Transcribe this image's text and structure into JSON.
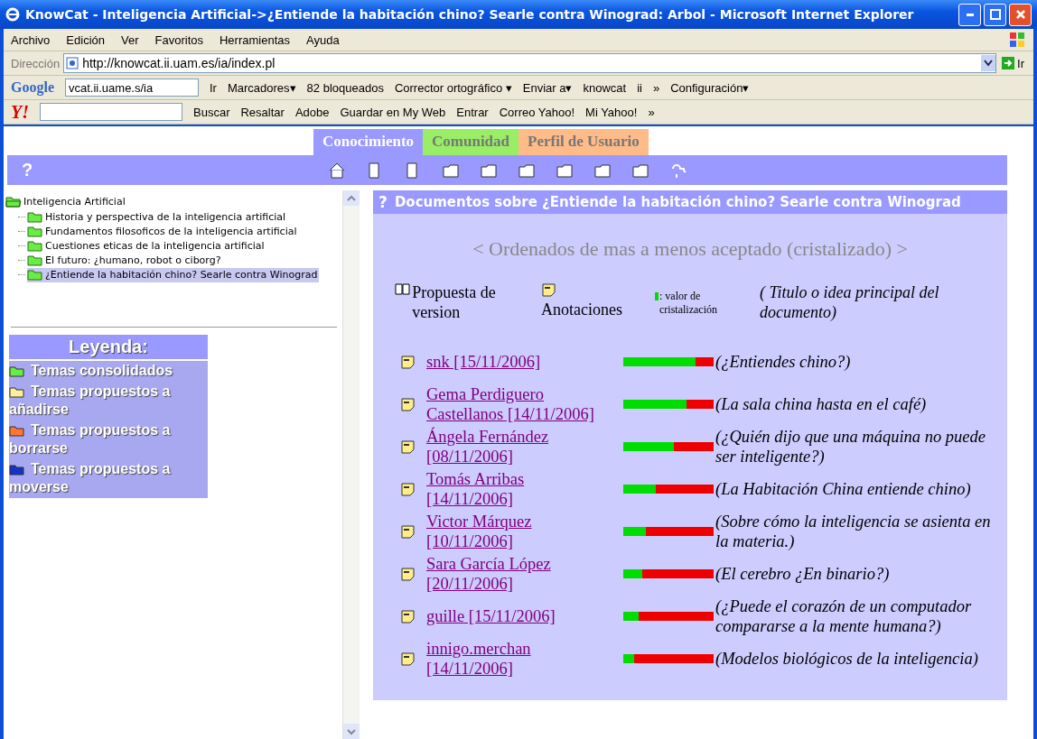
{
  "window": {
    "title": "KnowCat - Inteligencia Artificial->¿Entiende la habitación chino? Searle contra Winograd: Arbol - Microsoft Internet Explorer"
  },
  "menu": [
    "Archivo",
    "Edición",
    "Ver",
    "Favoritos",
    "Herramientas",
    "Ayuda"
  ],
  "address": {
    "label": "Dirección",
    "url": "http://knowcat.ii.uam.es/ia/index.pl",
    "go": "Ir"
  },
  "google_toolbar": {
    "logo": "Google",
    "search_value": "vcat.ii.uame.s/ia",
    "items": [
      "Ir",
      "Marcadores▾",
      "82 bloqueados",
      "Corrector ortográfico ▾",
      "Enviar a▾",
      "knowcat",
      "ii",
      "»",
      "Configuración▾"
    ]
  },
  "yahoo_toolbar": {
    "logo": "Y!",
    "items": [
      "Buscar",
      "Resaltar",
      "Adobe",
      "Guardar en My Web",
      "Entrar",
      "Correo Yahoo!",
      "Mi Yahoo!",
      "»"
    ]
  },
  "tabs": [
    {
      "label": "Conocimiento",
      "selected": true,
      "color": "#9999ff"
    },
    {
      "label": "Comunidad",
      "selected": false,
      "color": "#99ee66"
    },
    {
      "label": "Perfil de Usuario",
      "selected": false,
      "color": "#ffbb88"
    }
  ],
  "nav_help": "?",
  "tree": {
    "label": "Inteligencia Artificial",
    "expanded": true,
    "selected": false,
    "children": [
      {
        "label": "Historia y perspectiva de la inteligencia artificial",
        "selected": false
      },
      {
        "label": "Fundamentos filosoficos de la inteligencia artificial",
        "selected": false
      },
      {
        "label": "Cuestiones eticas de la inteligencia artificial",
        "selected": false
      },
      {
        "label": "El futuro: ¿humano, robot o ciborg?",
        "selected": false
      },
      {
        "label": "¿Entiende la habitación chino? Searle contra Winograd",
        "selected": true
      }
    ]
  },
  "legend": {
    "title": "Leyenda:",
    "items": [
      {
        "label": "Temas consolidados",
        "color": "#66ee44"
      },
      {
        "label": "Temas propuestos a añadirse",
        "color": "#ffee99"
      },
      {
        "label": "Temas propuestos a borrarse",
        "color": "#ff7733"
      },
      {
        "label": "Temas propuestos a moverse",
        "color": "#1133cc"
      }
    ]
  },
  "panel": {
    "help": "?",
    "title": "Documentos sobre ¿Entiende la habitación chino? Searle contra Winograd",
    "subtitle": "< Ordenados de mas a menos aceptado (cristalizado) >",
    "header": {
      "proposal": "Propuesta de version",
      "annotations": "Anotaciones",
      "legend_note": ": valor de cristalización",
      "title_note": "( Titulo o idea principal del documento)"
    },
    "documents": [
      {
        "author": "snk [15/11/2006]",
        "level": 0.8,
        "title": "(¿Entiendes chino?)"
      },
      {
        "author": "Gema Perdiguero Castellanos [14/11/2006]",
        "level": 0.7,
        "title": "(La sala china hasta en el café)"
      },
      {
        "author": "Ángela Fernández [08/11/2006]",
        "level": 0.56,
        "title": "(¿Quién dijo que una máquina no puede ser inteligente?)"
      },
      {
        "author": "Tomás Arribas [14/11/2006]",
        "level": 0.36,
        "title": "(La Habitación China entiende chino)"
      },
      {
        "author": "Victor Márquez [10/11/2006]",
        "level": 0.25,
        "title": "(Sobre cómo la inteligencia se asienta en la materia.)"
      },
      {
        "author": "Sara García López [20/11/2006]",
        "level": 0.21,
        "title": "(El cerebro ¿En binario?)"
      },
      {
        "author": "guille [15/11/2006]",
        "level": 0.17,
        "title": "(¿Puede el corazón de un computador compararse a la mente humana?)"
      },
      {
        "author": "innigo.merchan [14/11/2006]",
        "level": 0.12,
        "title": "(Modelos biológicos de la inteligencia)"
      }
    ]
  }
}
